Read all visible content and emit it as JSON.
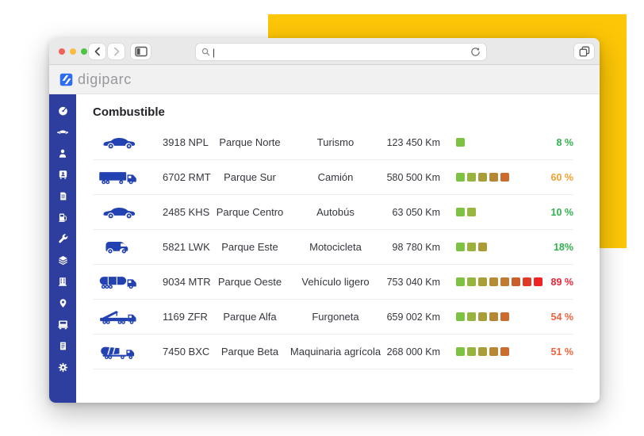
{
  "colors": {
    "accent": "#fdc607",
    "sidebar": "#2d3e9f",
    "vehicle": "#2342b2",
    "logo": "#2e6cf3"
  },
  "browser": {
    "traffic_light_colors": [
      "#f4605a",
      "#f8bd40",
      "#50c341"
    ],
    "url_value": "",
    "url_cursor": "|"
  },
  "app_header": {
    "logo_text": "digiparc"
  },
  "sidebar": {
    "items": [
      {
        "icon": "dashboard"
      },
      {
        "icon": "car"
      },
      {
        "icon": "driver"
      },
      {
        "icon": "bus-driver"
      },
      {
        "icon": "invoice"
      },
      {
        "icon": "fuel-pump"
      },
      {
        "icon": "wrench"
      },
      {
        "icon": "layers"
      },
      {
        "icon": "building"
      },
      {
        "icon": "location-pin"
      },
      {
        "icon": "truck"
      },
      {
        "icon": "report"
      },
      {
        "icon": "settings"
      }
    ]
  },
  "main": {
    "title": "Combustible",
    "table": {
      "rows": [
        {
          "icon": "car",
          "plate": "3918 NPL",
          "park": "Parque Norte",
          "type": "Turismo",
          "km": "123 450 Km",
          "fuel_squares": [
            "#7dc242"
          ],
          "percent": "8 %",
          "percent_color": "#2fb14f"
        },
        {
          "icon": "semi-truck",
          "plate": "6702 RMT",
          "park": "Parque Sur",
          "type": "Camión",
          "km": "580 500 Km",
          "fuel_squares": [
            "#7dc242",
            "#98b43e",
            "#a89e39",
            "#b88734",
            "#c96c2e"
          ],
          "percent": "60 %",
          "percent_color": "#f5a02c"
        },
        {
          "icon": "car",
          "plate": "2485 KHS",
          "park": "Parque Centro",
          "type": "Autobús",
          "km": "63 050 Km",
          "fuel_squares": [
            "#7dc242",
            "#9ab63e"
          ],
          "percent": "10 %",
          "percent_color": "#2fb14f"
        },
        {
          "icon": "van",
          "plate": "5821 LWK",
          "park": "Parque Este",
          "type": "Motocicleta",
          "km": "98 780 Km",
          "fuel_squares": [
            "#7dc242",
            "#9cb23d",
            "#ab9a38"
          ],
          "percent": "18%",
          "percent_color": "#2fb14f"
        },
        {
          "icon": "tanker-truck",
          "plate": "9034 MTR",
          "park": "Parque Oeste",
          "type": "Vehículo ligero",
          "km": "753 040 Km",
          "fuel_squares": [
            "#7dc242",
            "#96b53e",
            "#a7a039",
            "#b58c35",
            "#c07b32",
            "#ca5f2c",
            "#dd3b26",
            "#ee2322"
          ],
          "percent": "89 %",
          "percent_color": "#ee2334"
        },
        {
          "icon": "crane-truck",
          "plate": "1169 ZFR",
          "park": "Parque Alfa",
          "type": "Furgoneta",
          "km": "659 002 Km",
          "fuel_squares": [
            "#7dc242",
            "#98b43e",
            "#a89e39",
            "#b88734",
            "#c96c2e"
          ],
          "percent": "54 %",
          "percent_color": "#f1633c"
        },
        {
          "icon": "mixer-truck",
          "plate": "7450 BXC",
          "park": "Parque Beta",
          "type": "Maquinaria agrícola",
          "km": "268 000 Km",
          "fuel_squares": [
            "#7dc242",
            "#98b43e",
            "#a89e39",
            "#b88734",
            "#c96c2e"
          ],
          "percent": "51 %",
          "percent_color": "#f1633c"
        }
      ]
    }
  }
}
